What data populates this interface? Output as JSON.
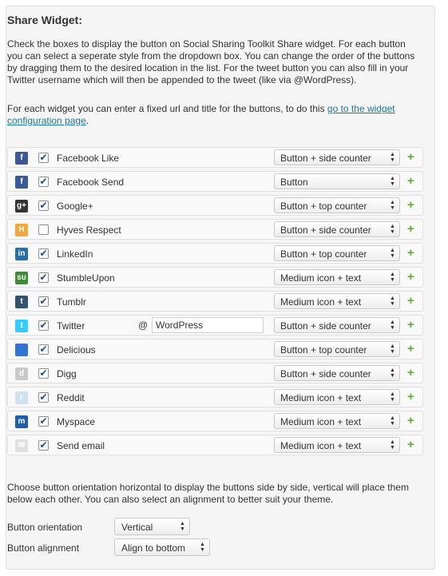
{
  "widget": {
    "title": "Share Widget:",
    "intro": "Check the boxes to display the button on Social Sharing Toolkit Share widget. For each button you can select a seperate style from the dropdown box. You can change the order of the buttons by dragging them to the desired location in the list. For the tweet button you can also fill in your Twitter username which will then be appended to the tweet (like via @WordPress).",
    "config_text": "For each widget you can enter a fixed url and title for the buttons, to do this ",
    "config_link": "go to the widget configuration page",
    "config_end": ".",
    "at_sign": "@",
    "add_symbol": "+"
  },
  "services": [
    {
      "label": "Facebook Like",
      "checked": true,
      "style": "Button + side counter",
      "icon": "facebook-icon",
      "color": "#3b5998",
      "glyph": "f"
    },
    {
      "label": "Facebook Send",
      "checked": true,
      "style": "Button",
      "icon": "facebook-icon",
      "color": "#3b5998",
      "glyph": "f"
    },
    {
      "label": "Google+",
      "checked": true,
      "style": "Button + top counter",
      "icon": "google-plus-icon",
      "color": "#333333",
      "glyph": "g+"
    },
    {
      "label": "Hyves Respect",
      "checked": false,
      "style": "Button + side counter",
      "icon": "hyves-icon",
      "color": "#f2a83a",
      "glyph": "H"
    },
    {
      "label": "LinkedIn",
      "checked": true,
      "style": "Button + top counter",
      "icon": "linkedin-icon",
      "color": "#2a6ea6",
      "glyph": "in"
    },
    {
      "label": "StumbleUpon",
      "checked": true,
      "style": "Medium icon + text",
      "icon": "stumbleupon-icon",
      "color": "#3e8b3a",
      "glyph": "su"
    },
    {
      "label": "Tumblr",
      "checked": true,
      "style": "Medium icon + text",
      "icon": "tumblr-icon",
      "color": "#34526f",
      "glyph": "t"
    },
    {
      "label": "Twitter",
      "checked": true,
      "style": "Button + side counter",
      "icon": "twitter-icon",
      "color": "#33ccff",
      "glyph": "t",
      "username": "WordPress"
    },
    {
      "label": "Delicious",
      "checked": true,
      "style": "Button + top counter",
      "icon": "delicious-icon",
      "color": "#3274d1",
      "glyph": ""
    },
    {
      "label": "Digg",
      "checked": true,
      "style": "Button + side counter",
      "icon": "digg-icon",
      "color": "#c9c9c9",
      "glyph": "d"
    },
    {
      "label": "Reddit",
      "checked": true,
      "style": "Medium icon + text",
      "icon": "reddit-icon",
      "color": "#cfe0f0",
      "glyph": "r"
    },
    {
      "label": "Myspace",
      "checked": true,
      "style": "Medium icon + text",
      "icon": "myspace-icon",
      "color": "#1d5fa8",
      "glyph": "m"
    },
    {
      "label": "Send email",
      "checked": true,
      "style": "Medium icon + text",
      "icon": "email-icon",
      "color": "#e0e0e0",
      "glyph": "✉"
    }
  ],
  "options": {
    "intro": "Choose button orientation horizontal to display the buttons side by side, vertical will place them below each other. You can also select an alignment to better suit your theme.",
    "orientation_label": "Button orientation",
    "orientation_value": "Vertical",
    "alignment_label": "Button alignment",
    "alignment_value": "Align to bottom"
  },
  "colors": {
    "accent_link": "#21759b",
    "add_button": "#5fae2f"
  }
}
